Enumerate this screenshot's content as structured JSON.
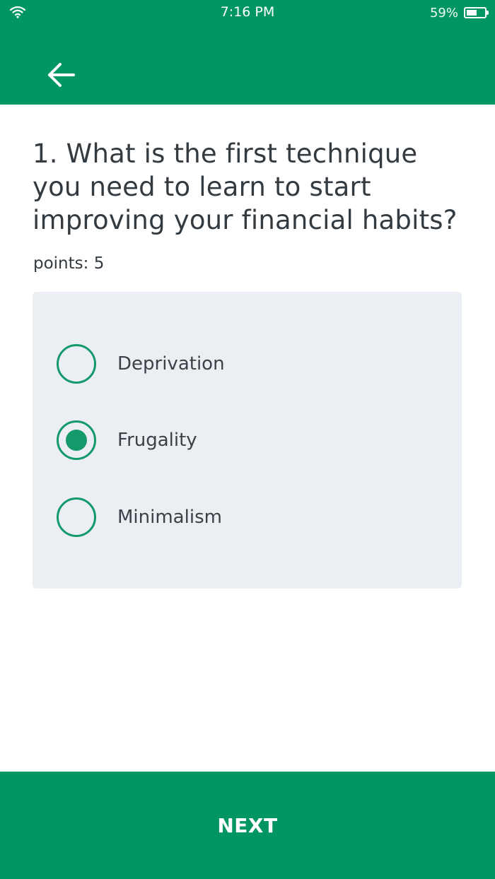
{
  "status_bar": {
    "time": "7:16 PM",
    "battery_percent_text": "59%",
    "battery_level": 0.59,
    "wifi_icon": "wifi-icon",
    "battery_icon": "battery-icon"
  },
  "header": {
    "back_icon": "arrow-left-icon"
  },
  "question": {
    "text": "1. What is the first technique you need to learn to start improving your financial habits?",
    "points": "points: 5"
  },
  "options": [
    {
      "label": "Deprivation",
      "selected": false
    },
    {
      "label": "Frugality",
      "selected": true
    },
    {
      "label": "Minimalism",
      "selected": false
    }
  ],
  "footer": {
    "next_label": "NEXT"
  },
  "colors": {
    "brand_green": "#009661",
    "radio_green": "#14996b",
    "card_bg": "#ebeef2",
    "text_dark": "#333a40"
  }
}
